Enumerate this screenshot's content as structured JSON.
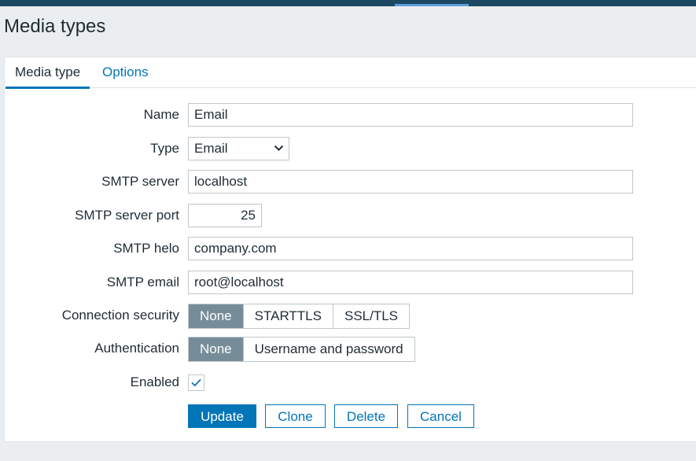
{
  "page": {
    "title": "Media types"
  },
  "tabs": [
    {
      "label": "Media type",
      "active": true
    },
    {
      "label": "Options",
      "active": false
    }
  ],
  "form": {
    "name": {
      "label": "Name",
      "value": "Email"
    },
    "type": {
      "label": "Type",
      "value": "Email"
    },
    "smtp_server": {
      "label": "SMTP server",
      "value": "localhost"
    },
    "smtp_port": {
      "label": "SMTP server port",
      "value": "25"
    },
    "smtp_helo": {
      "label": "SMTP helo",
      "value": "company.com"
    },
    "smtp_email": {
      "label": "SMTP email",
      "value": "root@localhost"
    },
    "connection_security": {
      "label": "Connection security",
      "options": [
        "None",
        "STARTTLS",
        "SSL/TLS"
      ],
      "selected": "None"
    },
    "authentication": {
      "label": "Authentication",
      "options": [
        "None",
        "Username and password"
      ],
      "selected": "None"
    },
    "enabled": {
      "label": "Enabled",
      "checked": true
    }
  },
  "buttons": {
    "update": "Update",
    "clone": "Clone",
    "delete": "Delete",
    "cancel": "Cancel"
  },
  "colors": {
    "accent": "#0275b8",
    "header_bar": "#1d4863",
    "segment_active": "#768d99",
    "background": "#ebeef0"
  }
}
